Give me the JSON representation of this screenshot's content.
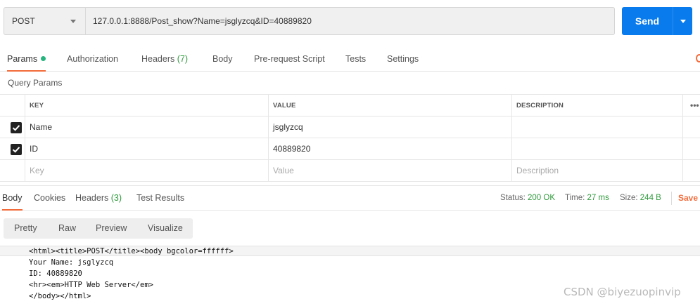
{
  "request": {
    "method": "POST",
    "url": "127.0.0.1:8888/Post_show?Name=jsglyzcq&ID=40889820",
    "send_label": "Send"
  },
  "request_tabs": {
    "params": "Params",
    "authorization": "Authorization",
    "headers": "Headers",
    "headers_count": "(7)",
    "body": "Body",
    "pre_request": "Pre-request Script",
    "tests": "Tests",
    "settings": "Settings"
  },
  "query_params": {
    "title": "Query Params",
    "columns": [
      "KEY",
      "VALUE",
      "DESCRIPTION"
    ],
    "more": "•••",
    "rows": [
      {
        "key": "Name",
        "value": "jsglyzcq",
        "description": "",
        "checked": true
      },
      {
        "key": "ID",
        "value": "40889820",
        "description": "",
        "checked": true
      }
    ],
    "placeholders": {
      "key": "Key",
      "value": "Value",
      "description": "Description"
    }
  },
  "response_tabs": {
    "body": "Body",
    "cookies": "Cookies",
    "headers": "Headers",
    "headers_count": "(3)",
    "test_results": "Test Results"
  },
  "response_status": {
    "status_label": "Status:",
    "status_value": "200 OK",
    "time_label": "Time:",
    "time_value": "27 ms",
    "size_label": "Size:",
    "size_value": "244 B",
    "save_label": "Save"
  },
  "view_modes": [
    "Pretty",
    "Raw",
    "Preview",
    "Visualize"
  ],
  "response_body": [
    "<html><title>POST</title><body bgcolor=ffffff>",
    "Your Name: jsglyzcq",
    "ID: 40889820",
    "<hr><em>HTTP Web Server</em>",
    "</body></html>"
  ],
  "watermark": "CSDN @biyezuopinvip",
  "colors": {
    "accent": "#f26b3a",
    "send": "#097bed",
    "success": "#2f9a3c",
    "dot": "#26b47f"
  }
}
